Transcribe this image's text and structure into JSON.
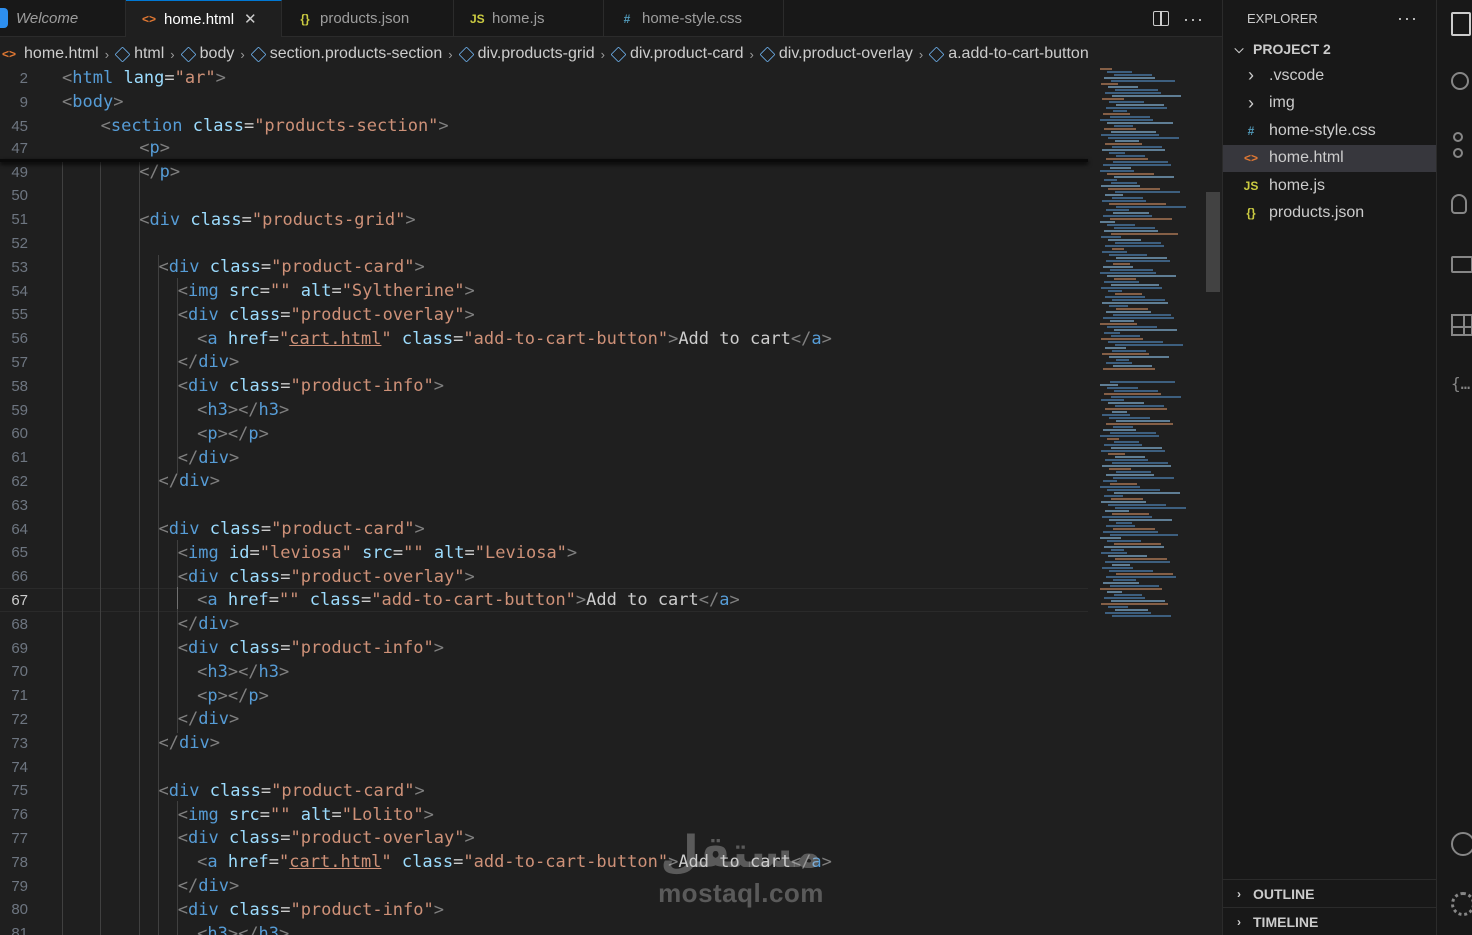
{
  "tabs": [
    {
      "label": "Welcome",
      "icon": "vscode-icon",
      "active": false
    },
    {
      "label": "home.html",
      "icon": "html-icon",
      "glyph": "<>",
      "color": "#e37933",
      "active": true
    },
    {
      "label": "products.json",
      "icon": "json-icon",
      "glyph": "{}",
      "color": "#cbcb41",
      "active": false
    },
    {
      "label": "home.js",
      "icon": "js-icon",
      "glyph": "JS",
      "color": "#cbcb41",
      "active": false
    },
    {
      "label": "home-style.css",
      "icon": "css-icon",
      "glyph": "#",
      "color": "#519aba",
      "active": false
    }
  ],
  "close_glyph": "✕",
  "breadcrumb": [
    "home.html",
    "html",
    "body",
    "section.products-section",
    "div.products-grid",
    "div.product-card",
    "div.product-overlay",
    "a.add-to-cart-button"
  ],
  "current_line": "67",
  "lines": [
    {
      "n": "2",
      "sticky": true,
      "indent": 0,
      "tokens": [
        [
          "p",
          "<"
        ],
        [
          "t",
          "html"
        ],
        [
          "c",
          " "
        ],
        [
          "a",
          "lang"
        ],
        [
          "c",
          "="
        ],
        [
          "s",
          "\"ar\""
        ],
        [
          "p",
          ">"
        ]
      ]
    },
    {
      "n": "9",
      "sticky": true,
      "indent": 0,
      "tokens": [
        [
          "p",
          "<"
        ],
        [
          "t",
          "body"
        ],
        [
          "p",
          ">"
        ]
      ]
    },
    {
      "n": "45",
      "sticky": true,
      "indent": 2,
      "tokens": [
        [
          "p",
          "<"
        ],
        [
          "t",
          "section"
        ],
        [
          "c",
          " "
        ],
        [
          "a",
          "class"
        ],
        [
          "c",
          "="
        ],
        [
          "s",
          "\"products-section\""
        ],
        [
          "p",
          ">"
        ]
      ]
    },
    {
      "n": "47",
      "sticky": true,
      "indent": 4,
      "tokens": [
        [
          "p",
          "<"
        ],
        [
          "t",
          "p"
        ],
        [
          "p",
          ">"
        ]
      ]
    },
    {
      "n": "49",
      "indent": 4,
      "tokens": [
        [
          "p",
          "</"
        ],
        [
          "t",
          "p"
        ],
        [
          "p",
          ">"
        ]
      ]
    },
    {
      "n": "50",
      "indent": 0,
      "tokens": []
    },
    {
      "n": "51",
      "indent": 4,
      "tokens": [
        [
          "p",
          "<"
        ],
        [
          "t",
          "div"
        ],
        [
          "c",
          " "
        ],
        [
          "a",
          "class"
        ],
        [
          "c",
          "="
        ],
        [
          "s",
          "\"products-grid\""
        ],
        [
          "p",
          ">"
        ]
      ]
    },
    {
      "n": "52",
      "indent": 0,
      "tokens": []
    },
    {
      "n": "53",
      "indent": 5,
      "tokens": [
        [
          "p",
          "<"
        ],
        [
          "t",
          "div"
        ],
        [
          "c",
          " "
        ],
        [
          "a",
          "class"
        ],
        [
          "c",
          "="
        ],
        [
          "s",
          "\"product-card\""
        ],
        [
          "p",
          ">"
        ]
      ]
    },
    {
      "n": "54",
      "indent": 6,
      "tokens": [
        [
          "p",
          "<"
        ],
        [
          "t",
          "img"
        ],
        [
          "c",
          " "
        ],
        [
          "a",
          "src"
        ],
        [
          "c",
          "="
        ],
        [
          "s",
          "\"\""
        ],
        [
          "c",
          " "
        ],
        [
          "a",
          "alt"
        ],
        [
          "c",
          "="
        ],
        [
          "s",
          "\"Syltherine\""
        ],
        [
          "p",
          ">"
        ]
      ]
    },
    {
      "n": "55",
      "indent": 6,
      "tokens": [
        [
          "p",
          "<"
        ],
        [
          "t",
          "div"
        ],
        [
          "c",
          " "
        ],
        [
          "a",
          "class"
        ],
        [
          "c",
          "="
        ],
        [
          "s",
          "\"product-overlay\""
        ],
        [
          "p",
          ">"
        ]
      ]
    },
    {
      "n": "56",
      "indent": 7,
      "tokens": [
        [
          "p",
          "<"
        ],
        [
          "t",
          "a"
        ],
        [
          "c",
          " "
        ],
        [
          "a",
          "href"
        ],
        [
          "c",
          "="
        ],
        [
          "s",
          "\""
        ],
        [
          "su",
          "cart.html"
        ],
        [
          "s",
          "\""
        ],
        [
          "c",
          " "
        ],
        [
          "a",
          "class"
        ],
        [
          "c",
          "="
        ],
        [
          "s",
          "\"add-to-cart-button\""
        ],
        [
          "p",
          ">"
        ],
        [
          "c",
          "Add to cart"
        ],
        [
          "p",
          "</"
        ],
        [
          "t",
          "a"
        ],
        [
          "p",
          ">"
        ]
      ]
    },
    {
      "n": "57",
      "indent": 6,
      "tokens": [
        [
          "p",
          "</"
        ],
        [
          "t",
          "div"
        ],
        [
          "p",
          ">"
        ]
      ]
    },
    {
      "n": "58",
      "indent": 6,
      "tokens": [
        [
          "p",
          "<"
        ],
        [
          "t",
          "div"
        ],
        [
          "c",
          " "
        ],
        [
          "a",
          "class"
        ],
        [
          "c",
          "="
        ],
        [
          "s",
          "\"product-info\""
        ],
        [
          "p",
          ">"
        ]
      ]
    },
    {
      "n": "59",
      "indent": 7,
      "tokens": [
        [
          "p",
          "<"
        ],
        [
          "t",
          "h3"
        ],
        [
          "p",
          "></"
        ],
        [
          "t",
          "h3"
        ],
        [
          "p",
          ">"
        ]
      ]
    },
    {
      "n": "60",
      "indent": 7,
      "tokens": [
        [
          "p",
          "<"
        ],
        [
          "t",
          "p"
        ],
        [
          "p",
          "></"
        ],
        [
          "t",
          "p"
        ],
        [
          "p",
          ">"
        ]
      ]
    },
    {
      "n": "61",
      "indent": 6,
      "tokens": [
        [
          "p",
          "</"
        ],
        [
          "t",
          "div"
        ],
        [
          "p",
          ">"
        ]
      ]
    },
    {
      "n": "62",
      "indent": 5,
      "tokens": [
        [
          "p",
          "</"
        ],
        [
          "t",
          "div"
        ],
        [
          "p",
          ">"
        ]
      ]
    },
    {
      "n": "63",
      "indent": 0,
      "tokens": []
    },
    {
      "n": "64",
      "indent": 5,
      "tokens": [
        [
          "p",
          "<"
        ],
        [
          "t",
          "div"
        ],
        [
          "c",
          " "
        ],
        [
          "a",
          "class"
        ],
        [
          "c",
          "="
        ],
        [
          "s",
          "\"product-card\""
        ],
        [
          "p",
          ">"
        ]
      ]
    },
    {
      "n": "65",
      "indent": 6,
      "tokens": [
        [
          "p",
          "<"
        ],
        [
          "t",
          "img"
        ],
        [
          "c",
          " "
        ],
        [
          "a",
          "id"
        ],
        [
          "c",
          "="
        ],
        [
          "s",
          "\"leviosa\""
        ],
        [
          "c",
          " "
        ],
        [
          "a",
          "src"
        ],
        [
          "c",
          "="
        ],
        [
          "s",
          "\"\""
        ],
        [
          "c",
          " "
        ],
        [
          "a",
          "alt"
        ],
        [
          "c",
          "="
        ],
        [
          "s",
          "\"Leviosa\""
        ],
        [
          "p",
          ">"
        ]
      ]
    },
    {
      "n": "66",
      "indent": 6,
      "tokens": [
        [
          "p",
          "<"
        ],
        [
          "t",
          "div"
        ],
        [
          "c",
          " "
        ],
        [
          "a",
          "class"
        ],
        [
          "c",
          "="
        ],
        [
          "s",
          "\"product-overlay\""
        ],
        [
          "p",
          ">"
        ]
      ]
    },
    {
      "n": "67",
      "indent": 7,
      "tokens": [
        [
          "p",
          "<"
        ],
        [
          "t",
          "a"
        ],
        [
          "c",
          " "
        ],
        [
          "a",
          "href"
        ],
        [
          "c",
          "="
        ],
        [
          "s",
          "\"\""
        ],
        [
          "c",
          " "
        ],
        [
          "a",
          "class"
        ],
        [
          "c",
          "="
        ],
        [
          "s",
          "\"add-to-cart-button\""
        ],
        [
          "p",
          ">"
        ],
        [
          "c",
          "Add to cart"
        ],
        [
          "p",
          "</"
        ],
        [
          "t",
          "a"
        ],
        [
          "p",
          ">"
        ]
      ]
    },
    {
      "n": "68",
      "indent": 6,
      "tokens": [
        [
          "p",
          "</"
        ],
        [
          "t",
          "div"
        ],
        [
          "p",
          ">"
        ]
      ]
    },
    {
      "n": "69",
      "indent": 6,
      "tokens": [
        [
          "p",
          "<"
        ],
        [
          "t",
          "div"
        ],
        [
          "c",
          " "
        ],
        [
          "a",
          "class"
        ],
        [
          "c",
          "="
        ],
        [
          "s",
          "\"product-info\""
        ],
        [
          "p",
          ">"
        ]
      ]
    },
    {
      "n": "70",
      "indent": 7,
      "tokens": [
        [
          "p",
          "<"
        ],
        [
          "t",
          "h3"
        ],
        [
          "p",
          "></"
        ],
        [
          "t",
          "h3"
        ],
        [
          "p",
          ">"
        ]
      ]
    },
    {
      "n": "71",
      "indent": 7,
      "tokens": [
        [
          "p",
          "<"
        ],
        [
          "t",
          "p"
        ],
        [
          "p",
          "></"
        ],
        [
          "t",
          "p"
        ],
        [
          "p",
          ">"
        ]
      ]
    },
    {
      "n": "72",
      "indent": 6,
      "tokens": [
        [
          "p",
          "</"
        ],
        [
          "t",
          "div"
        ],
        [
          "p",
          ">"
        ]
      ]
    },
    {
      "n": "73",
      "indent": 5,
      "tokens": [
        [
          "p",
          "</"
        ],
        [
          "t",
          "div"
        ],
        [
          "p",
          ">"
        ]
      ]
    },
    {
      "n": "74",
      "indent": 0,
      "tokens": []
    },
    {
      "n": "75",
      "indent": 5,
      "tokens": [
        [
          "p",
          "<"
        ],
        [
          "t",
          "div"
        ],
        [
          "c",
          " "
        ],
        [
          "a",
          "class"
        ],
        [
          "c",
          "="
        ],
        [
          "s",
          "\"product-card\""
        ],
        [
          "p",
          ">"
        ]
      ]
    },
    {
      "n": "76",
      "indent": 6,
      "tokens": [
        [
          "p",
          "<"
        ],
        [
          "t",
          "img"
        ],
        [
          "c",
          " "
        ],
        [
          "a",
          "src"
        ],
        [
          "c",
          "="
        ],
        [
          "s",
          "\"\""
        ],
        [
          "c",
          " "
        ],
        [
          "a",
          "alt"
        ],
        [
          "c",
          "="
        ],
        [
          "s",
          "\"Lolito\""
        ],
        [
          "p",
          ">"
        ]
      ]
    },
    {
      "n": "77",
      "indent": 6,
      "tokens": [
        [
          "p",
          "<"
        ],
        [
          "t",
          "div"
        ],
        [
          "c",
          " "
        ],
        [
          "a",
          "class"
        ],
        [
          "c",
          "="
        ],
        [
          "s",
          "\"product-overlay\""
        ],
        [
          "p",
          ">"
        ]
      ]
    },
    {
      "n": "78",
      "indent": 7,
      "tokens": [
        [
          "p",
          "<"
        ],
        [
          "t",
          "a"
        ],
        [
          "c",
          " "
        ],
        [
          "a",
          "href"
        ],
        [
          "c",
          "="
        ],
        [
          "s",
          "\""
        ],
        [
          "su",
          "cart.html"
        ],
        [
          "s",
          "\""
        ],
        [
          "c",
          " "
        ],
        [
          "a",
          "class"
        ],
        [
          "c",
          "="
        ],
        [
          "s",
          "\"add-to-cart-button\""
        ],
        [
          "p",
          ">"
        ],
        [
          "c",
          "Add to cart"
        ],
        [
          "p",
          "</"
        ],
        [
          "t",
          "a"
        ],
        [
          "p",
          ">"
        ]
      ]
    },
    {
      "n": "79",
      "indent": 6,
      "tokens": [
        [
          "p",
          "</"
        ],
        [
          "t",
          "div"
        ],
        [
          "p",
          ">"
        ]
      ]
    },
    {
      "n": "80",
      "indent": 6,
      "tokens": [
        [
          "p",
          "<"
        ],
        [
          "t",
          "div"
        ],
        [
          "c",
          " "
        ],
        [
          "a",
          "class"
        ],
        [
          "c",
          "="
        ],
        [
          "s",
          "\"product-info\""
        ],
        [
          "p",
          ">"
        ]
      ]
    },
    {
      "n": "81",
      "indent": 7,
      "tokens": [
        [
          "p",
          "<"
        ],
        [
          "t",
          "h3"
        ],
        [
          "p",
          "></"
        ],
        [
          "t",
          "h3"
        ],
        [
          "p",
          ">"
        ]
      ]
    }
  ],
  "explorer": {
    "title": "EXPLORER",
    "project": "PROJECT 2",
    "items": [
      {
        "label": ".vscode",
        "type": "folder",
        "icon": "chevron-right-icon"
      },
      {
        "label": "img",
        "type": "folder",
        "icon": "chevron-right-icon"
      },
      {
        "label": "home-style.css",
        "type": "file",
        "icon": "css-icon",
        "glyph": "#",
        "color": "#519aba"
      },
      {
        "label": "home.html",
        "type": "file",
        "icon": "html-icon",
        "glyph": "<>",
        "color": "#e37933",
        "selected": true
      },
      {
        "label": "home.js",
        "type": "file",
        "icon": "js-icon",
        "glyph": "JS",
        "color": "#cbcb41"
      },
      {
        "label": "products.json",
        "type": "file",
        "icon": "json-icon",
        "glyph": "{}",
        "color": "#cbcb41"
      }
    ],
    "outline": "OUTLINE",
    "timeline": "TIMELINE"
  },
  "watermark": {
    "arabic": "مستقل",
    "latin": "mostaql.com"
  }
}
